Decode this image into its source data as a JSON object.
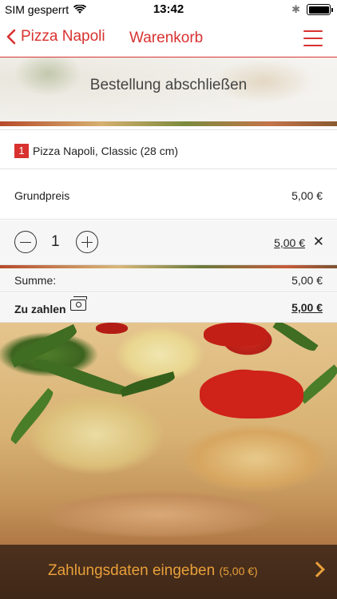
{
  "status_bar": {
    "carrier": "SIM gesperrt",
    "time": "13:42"
  },
  "nav": {
    "back_label": "Pizza Napoli",
    "title": "Warenkorb"
  },
  "headline": "Bestellung abschließen",
  "cart": {
    "item": {
      "quantity_badge": "1",
      "name": "Pizza Napoli, Classic (28 cm)"
    },
    "base_price": {
      "label": "Grundpreis",
      "value": "5,00 €"
    },
    "quantity": {
      "value": "1",
      "line_total": "5,00 €"
    },
    "sum": {
      "label": "Summe:",
      "value": "5,00 €"
    },
    "to_pay": {
      "label": "Zu zahlen",
      "value": "5,00 €"
    }
  },
  "bottom_bar": {
    "label": "Zahlungsdaten eingeben",
    "amount": "(5,00 €)"
  },
  "colors": {
    "accent": "#d8322f",
    "bottom_bar_bg": "#4a2e1b",
    "bottom_bar_text": "#e8a03a"
  },
  "icons": [
    "wifi-icon",
    "bluetooth-icon",
    "battery-icon",
    "chevron-left-icon",
    "hamburger-menu-icon",
    "minus-icon",
    "plus-icon",
    "close-icon",
    "cash-icon",
    "chevron-right-icon"
  ]
}
